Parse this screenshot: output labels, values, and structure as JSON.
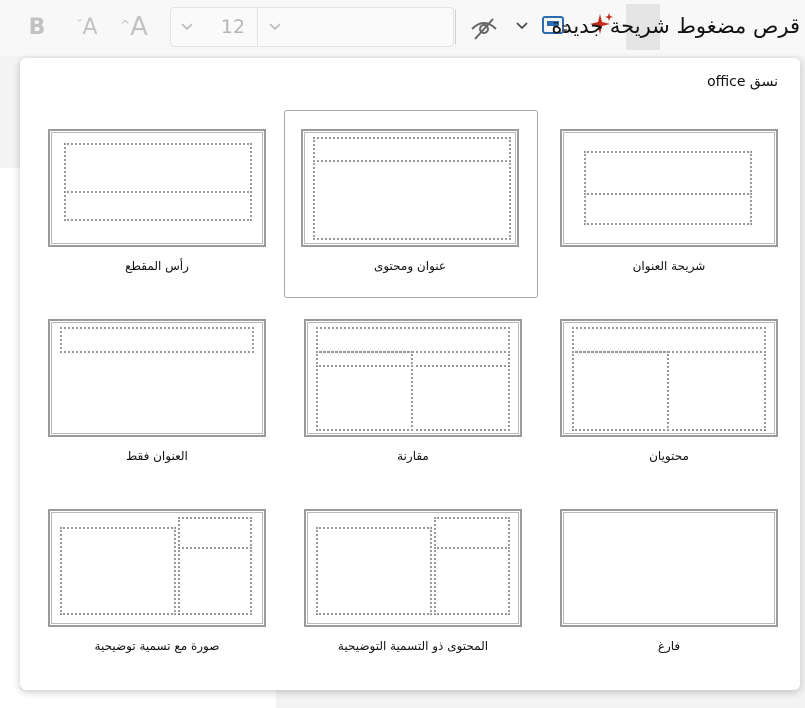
{
  "toolbar": {
    "bold_label": "B",
    "shrink_font_label": "A",
    "shrink_font_arrow": "ˇ",
    "grow_font_label": "A",
    "grow_font_arrow": "^",
    "font_size_value": "12",
    "chevron": "⌄"
  },
  "panel": {
    "title": "قرص مضغوط شريحة جديدة",
    "section_title": "نسق office",
    "layouts": [
      {
        "label": "رأس المقطع",
        "selected": false
      },
      {
        "label": "عنوان ومحتوى",
        "selected": true
      },
      {
        "label": "شريحة العنوان",
        "selected": false
      },
      {
        "label": "العنوان فقط",
        "selected": false
      },
      {
        "label": "مقارنة",
        "selected": false
      },
      {
        "label": "محتويان",
        "selected": false
      },
      {
        "label": "صورة مع تسمية توضيحية",
        "selected": false
      },
      {
        "label": "المحتوى ذو التسمية التوضيحية",
        "selected": false
      },
      {
        "label": "فارغ",
        "selected": false
      }
    ]
  },
  "colors": {
    "accent_red": "#c42b1c",
    "accent_blue": "#2b6cb0",
    "placeholder_border": "#9a9a9a"
  },
  "icons": [
    "bold-icon",
    "shrink-font-icon",
    "grow-font-icon",
    "hide-icon",
    "layout-icon",
    "designer-sparkle-icon"
  ]
}
